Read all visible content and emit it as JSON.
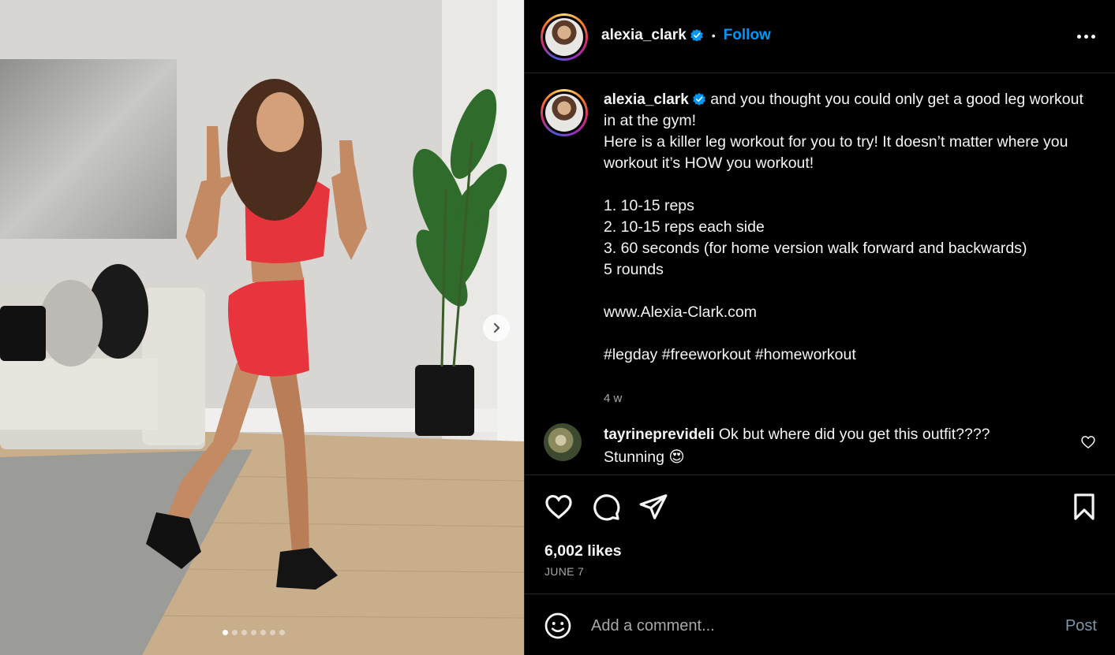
{
  "post": {
    "username": "alexia_clark",
    "follow_label": "Follow",
    "separator": "•",
    "caption_lines": [
      "and you thought you could only get a good leg workout in at the gym!",
      "Here is a killer leg workout for you to try! It doesn’t matter where you workout it’s HOW you workout!",
      "",
      "1. 10-15 reps",
      "2. 10-15 reps each side",
      "3. 60 seconds (for home version walk forward and backwards)",
      "5 rounds",
      "",
      "www.Alexia-Clark.com",
      "",
      "#legday #freeworkout #homeworkout"
    ],
    "time_ago": "4 w",
    "likes": "6,002 likes",
    "date": "JUNE 7",
    "carousel": {
      "total_slides": 7,
      "active_index": 0
    }
  },
  "comments": [
    {
      "username": "tayrineprevideli",
      "text": "Ok but where did you get this outfit????",
      "text2": "Stunning 😍"
    }
  ],
  "composer": {
    "placeholder": "Add a comment...",
    "post_label": "Post",
    "emoji_icon": "smiley-icon"
  },
  "colors": {
    "accent": "#0095f6",
    "background": "#000000",
    "muted": "#a8a8a8",
    "post_disabled": "#7e95ad"
  },
  "icons": [
    "verified-badge-icon",
    "more-options-icon",
    "heart-icon",
    "comment-icon",
    "share-icon",
    "bookmark-icon",
    "smiley-icon",
    "chevron-right-icon"
  ]
}
